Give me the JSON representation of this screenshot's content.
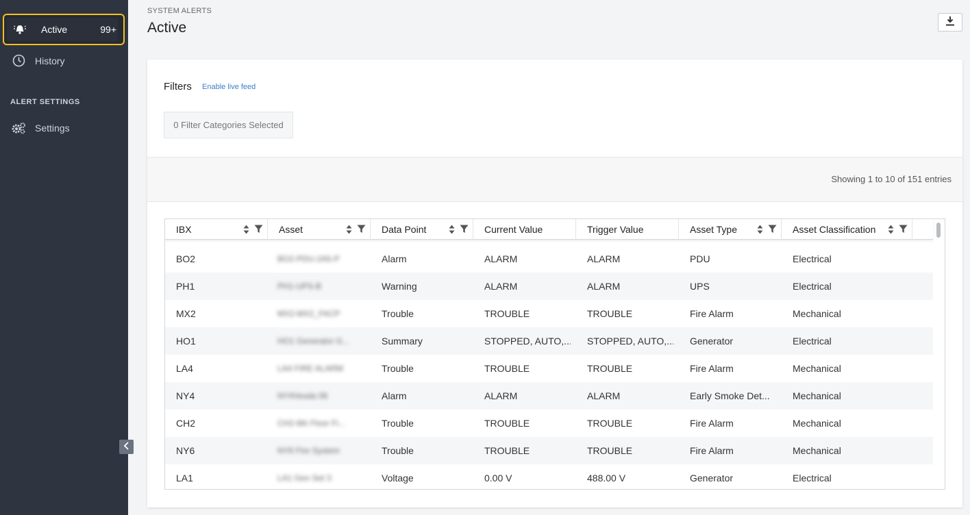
{
  "sidebar": {
    "active": {
      "label": "Active",
      "badge": "99+",
      "icon": "alarm-bell-icon"
    },
    "history": {
      "label": "History",
      "icon": "clock-icon"
    },
    "section": "ALERT SETTINGS",
    "settings": {
      "label": "Settings",
      "icon": "gears-icon"
    }
  },
  "header": {
    "supertitle": "SYSTEM ALERTS",
    "title": "Active"
  },
  "filters": {
    "title": "Filters",
    "live_feed_link": "Enable live feed",
    "selected_label": "0 Filter Categories Selected"
  },
  "table": {
    "showing": "Showing 1 to 10 of 151 entries",
    "columns": [
      {
        "label": "IBX",
        "sort": true,
        "filter": true
      },
      {
        "label": "Asset",
        "sort": true,
        "filter": true
      },
      {
        "label": "Data Point",
        "sort": true,
        "filter": true
      },
      {
        "label": "Current Value",
        "sort": false,
        "filter": false
      },
      {
        "label": "Trigger Value",
        "sort": false,
        "filter": false
      },
      {
        "label": "Asset Type",
        "sort": true,
        "filter": true
      },
      {
        "label": "Asset Classification",
        "sort": true,
        "filter": true
      }
    ],
    "rows": [
      {
        "ibx": "BO2",
        "asset": "BO2-PDU-2A5-P",
        "data_point": "Alarm",
        "current_value": "ALARM",
        "trigger_value": "ALARM",
        "asset_type": "PDU",
        "classification": "Electrical"
      },
      {
        "ibx": "PH1",
        "asset": "PH1-UPS-B",
        "data_point": "Warning",
        "current_value": "ALARM",
        "trigger_value": "ALARM",
        "asset_type": "UPS",
        "classification": "Electrical"
      },
      {
        "ibx": "MX2",
        "asset": "MX2-MX2_FACP",
        "data_point": "Trouble",
        "current_value": "TROUBLE",
        "trigger_value": "TROUBLE",
        "asset_type": "Fire Alarm",
        "classification": "Mechanical"
      },
      {
        "ibx": "HO1",
        "asset": "HO1 Generator G...",
        "data_point": "Summary",
        "current_value": "STOPPED, AUTO,...",
        "trigger_value": "STOPPED, AUTO,...",
        "asset_type": "Generator",
        "classification": "Electrical"
      },
      {
        "ibx": "LA4",
        "asset": "LA4 FIRE ALARM",
        "data_point": "Trouble",
        "current_value": "TROUBLE",
        "trigger_value": "TROUBLE",
        "asset_type": "Fire Alarm",
        "classification": "Mechanical"
      },
      {
        "ibx": "NY4",
        "asset": "NY4Vesda 06",
        "data_point": "Alarm",
        "current_value": "ALARM",
        "trigger_value": "ALARM",
        "asset_type": "Early Smoke Det...",
        "classification": "Mechanical"
      },
      {
        "ibx": "CH2",
        "asset": "CH2-6th Floor Fi...",
        "data_point": "Trouble",
        "current_value": "TROUBLE",
        "trigger_value": "TROUBLE",
        "asset_type": "Fire Alarm",
        "classification": "Mechanical"
      },
      {
        "ibx": "NY6",
        "asset": "NY6 Fire System",
        "data_point": "Trouble",
        "current_value": "TROUBLE",
        "trigger_value": "TROUBLE",
        "asset_type": "Fire Alarm",
        "classification": "Mechanical"
      },
      {
        "ibx": "LA1",
        "asset": "LA1 Gen Set 3",
        "data_point": "Voltage",
        "current_value": "0.00 V",
        "trigger_value": "488.00 V",
        "asset_type": "Generator",
        "classification": "Electrical"
      }
    ]
  },
  "colors": {
    "accent": "#f2c21b",
    "sidebar_bg": "#2f3441",
    "link": "#3a7ec7"
  }
}
